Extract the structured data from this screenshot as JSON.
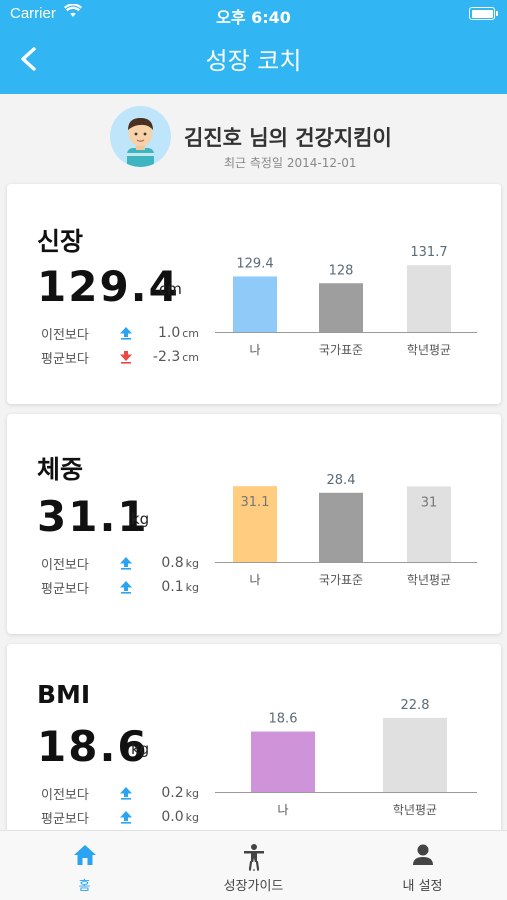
{
  "status": {
    "carrier": "Carrier",
    "time": "오후 6:40"
  },
  "header": {
    "title": "성장 코치",
    "back_icon": "chevron-left-icon"
  },
  "profile": {
    "name": "김진호 님의 건강지킴이",
    "date": "최근 측정일 2014-12-01"
  },
  "colors": {
    "accent": "#31b5f3",
    "up": "#2aa4f2",
    "down": "#e84848",
    "me_height": "#90caf9",
    "me_weight": "#ffcc80",
    "me_bmi": "#ce93d8",
    "national": "#9e9e9e",
    "grade": "#e0e0e0"
  },
  "cards": {
    "height": {
      "title": "신장",
      "value": "129.4",
      "unit": "cm",
      "prev_label": "이전보다",
      "prev_icon": "arrow-up-icon",
      "prev_value": "1.0",
      "prev_unit": "cm",
      "avg_label": "평균보다",
      "avg_icon": "arrow-down-icon",
      "avg_value": "-2.3",
      "avg_unit": "cm"
    },
    "weight": {
      "title": "체중",
      "value": "31.1",
      "unit": "kg",
      "prev_label": "이전보다",
      "prev_icon": "arrow-up-icon",
      "prev_value": "0.8",
      "prev_unit": "kg",
      "avg_label": "평균보다",
      "avg_icon": "arrow-up-icon",
      "avg_value": "0.1",
      "avg_unit": "kg"
    },
    "bmi": {
      "title": "BMI",
      "value": "18.6",
      "unit": "kg",
      "prev_label": "이전보다",
      "prev_icon": "arrow-up-icon",
      "prev_value": "0.2",
      "prev_unit": "kg",
      "avg_label": "평균보다",
      "avg_icon": "arrow-up-icon",
      "avg_value": "0.0",
      "avg_unit": "kg"
    }
  },
  "chart_data": [
    {
      "type": "bar",
      "categories": [
        "나",
        "국가표준",
        "학년평균"
      ],
      "values": [
        129.4,
        128,
        131.7
      ],
      "labels": [
        "129.4",
        "128",
        "131.7"
      ],
      "colors": [
        "#90caf9",
        "#9e9e9e",
        "#e0e0e0"
      ],
      "ylim": [
        118,
        134
      ]
    },
    {
      "type": "bar",
      "categories": [
        "나",
        "국가표준",
        "학년평균"
      ],
      "values": [
        31.1,
        28.4,
        31
      ],
      "labels": [
        "31.1",
        "28.4",
        "31"
      ],
      "colors": [
        "#ffcc80",
        "#9e9e9e",
        "#e0e0e0"
      ],
      "ylim": [
        0,
        32
      ]
    },
    {
      "type": "bar",
      "categories": [
        "나",
        "학년평균"
      ],
      "values": [
        18.6,
        22.8
      ],
      "labels": [
        "18.6",
        "22.8"
      ],
      "colors": [
        "#ce93d8",
        "#e0e0e0"
      ],
      "ylim": [
        0,
        24
      ]
    }
  ],
  "tabs": [
    {
      "label": "홈",
      "icon": "home-icon"
    },
    {
      "label": "성장가이드",
      "icon": "person-guide-icon"
    },
    {
      "label": "내 설정",
      "icon": "user-icon"
    }
  ]
}
